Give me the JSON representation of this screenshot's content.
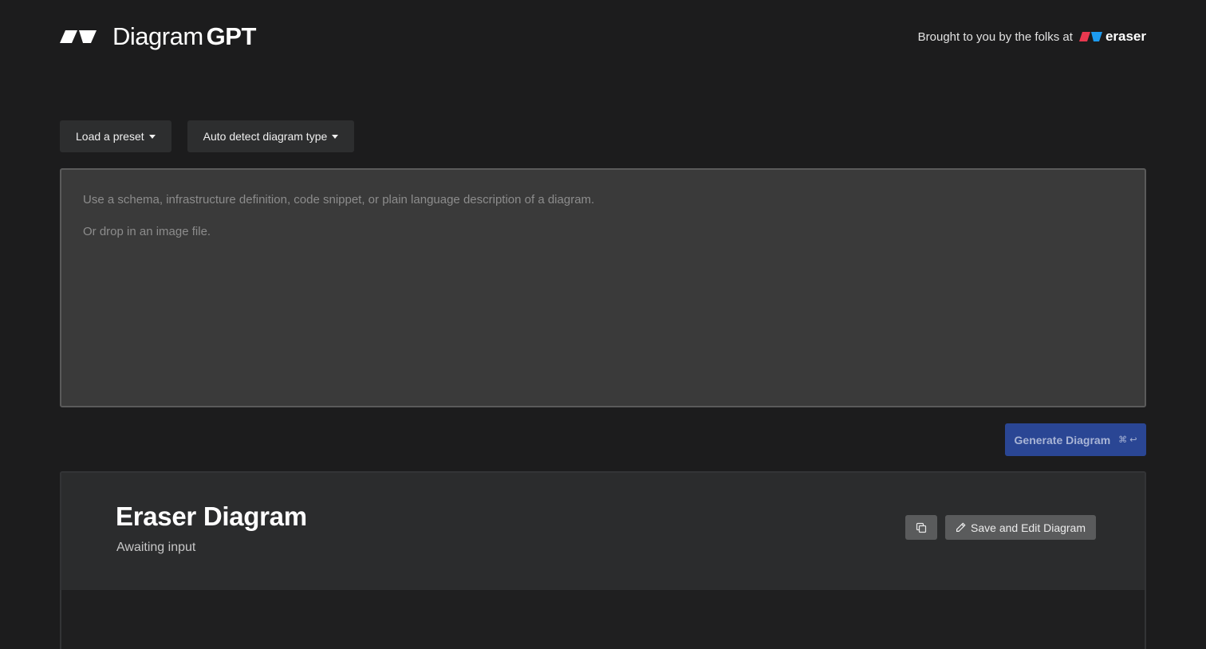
{
  "header": {
    "brand_light": "Diagram",
    "brand_bold": "GPT",
    "credit_text": "Brought to you by the folks at",
    "credit_brand": "eraser"
  },
  "toolbar": {
    "preset_label": "Load a preset",
    "diagram_type_label": "Auto detect diagram type"
  },
  "editor": {
    "placeholder_line1": "Use a schema, infrastructure definition, code snippet, or plain language description of a diagram.",
    "placeholder_line2": "Or drop in an image file."
  },
  "generate": {
    "label": "Generate Diagram",
    "shortcut": "⌘ ↩"
  },
  "output": {
    "title": "Eraser Diagram",
    "status": "Awaiting input",
    "save_label": "Save and Edit Diagram"
  },
  "icons": {
    "brand_logo": "eraser-logo-icon",
    "credit_logo": "eraser-color-logo-icon",
    "copy": "copy-icon",
    "pencil": "pencil-icon",
    "caret": "caret-down-icon"
  },
  "colors": {
    "background": "#1c1c1d",
    "generate_button": "#2a4694",
    "logo_red": "#e8384f",
    "logo_blue": "#1d9bf0"
  }
}
